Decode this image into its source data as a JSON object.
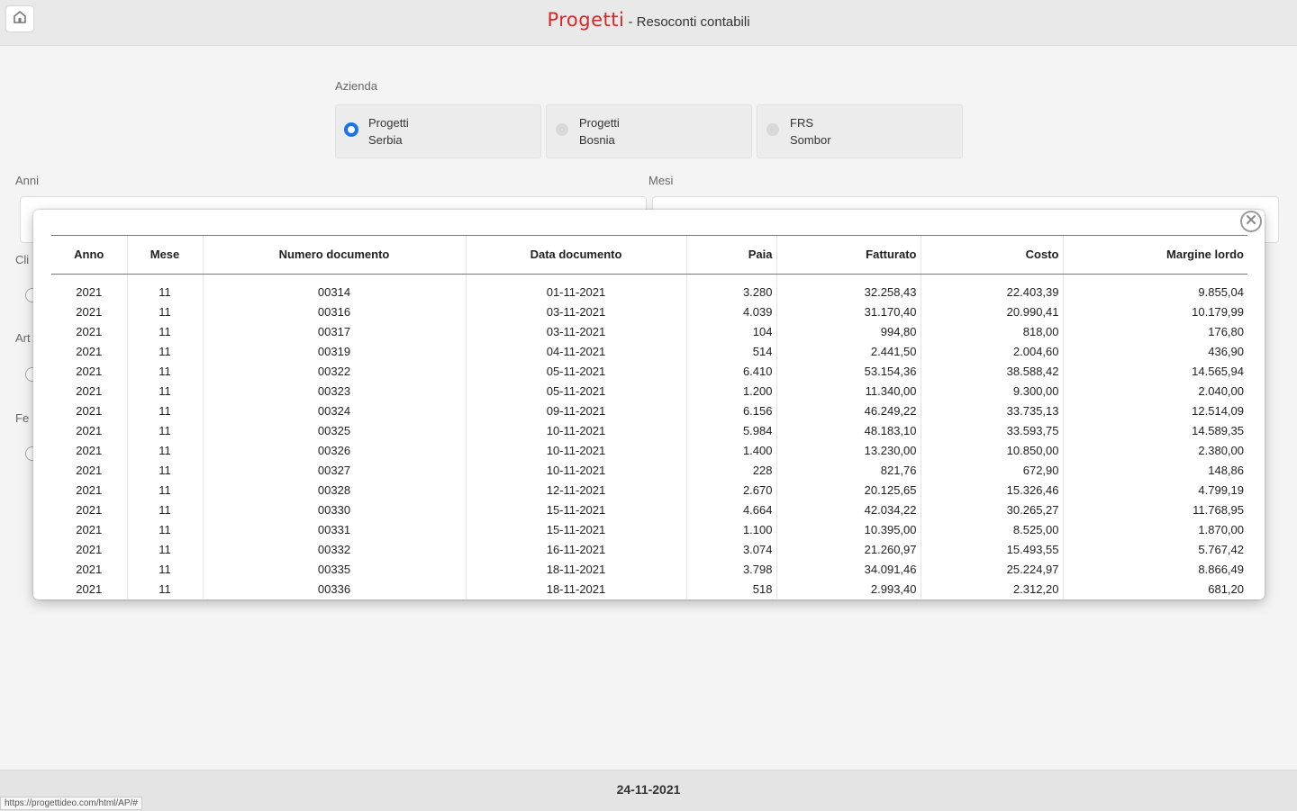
{
  "header": {
    "brand": "Progetti",
    "separator": " - ",
    "subtitle": "Resoconti contabili"
  },
  "azienda": {
    "label": "Azienda",
    "options": [
      {
        "line1": "Progetti",
        "line2": "Serbia",
        "selected": true
      },
      {
        "line1": "Progetti",
        "line2": "Bosnia",
        "selected": false
      },
      {
        "line1": "FRS",
        "line2": "Sombor",
        "selected": false
      }
    ]
  },
  "filters": {
    "anni_label": "Anni",
    "mesi_label": "Mesi",
    "cli_label": "Cli",
    "art_label": "Art",
    "fe_label": "Fe"
  },
  "table": {
    "columns": [
      "Anno",
      "Mese",
      "Numero documento",
      "Data documento",
      "Paia",
      "Fatturato",
      "Costo",
      "Margine lordo"
    ],
    "rows": [
      [
        "2021",
        "11",
        "00314",
        "01-11-2021",
        "3.280",
        "32.258,43",
        "22.403,39",
        "9.855,04"
      ],
      [
        "2021",
        "11",
        "00316",
        "03-11-2021",
        "4.039",
        "31.170,40",
        "20.990,41",
        "10.179,99"
      ],
      [
        "2021",
        "11",
        "00317",
        "03-11-2021",
        "104",
        "994,80",
        "818,00",
        "176,80"
      ],
      [
        "2021",
        "11",
        "00319",
        "04-11-2021",
        "514",
        "2.441,50",
        "2.004,60",
        "436,90"
      ],
      [
        "2021",
        "11",
        "00322",
        "05-11-2021",
        "6.410",
        "53.154,36",
        "38.588,42",
        "14.565,94"
      ],
      [
        "2021",
        "11",
        "00323",
        "05-11-2021",
        "1.200",
        "11.340,00",
        "9.300,00",
        "2.040,00"
      ],
      [
        "2021",
        "11",
        "00324",
        "09-11-2021",
        "6.156",
        "46.249,22",
        "33.735,13",
        "12.514,09"
      ],
      [
        "2021",
        "11",
        "00325",
        "10-11-2021",
        "5.984",
        "48.183,10",
        "33.593,75",
        "14.589,35"
      ],
      [
        "2021",
        "11",
        "00326",
        "10-11-2021",
        "1.400",
        "13.230,00",
        "10.850,00",
        "2.380,00"
      ],
      [
        "2021",
        "11",
        "00327",
        "10-11-2021",
        "228",
        "821,76",
        "672,90",
        "148,86"
      ],
      [
        "2021",
        "11",
        "00328",
        "12-11-2021",
        "2.670",
        "20.125,65",
        "15.326,46",
        "4.799,19"
      ],
      [
        "2021",
        "11",
        "00330",
        "15-11-2021",
        "4.664",
        "42.034,22",
        "30.265,27",
        "11.768,95"
      ],
      [
        "2021",
        "11",
        "00331",
        "15-11-2021",
        "1.100",
        "10.395,00",
        "8.525,00",
        "1.870,00"
      ],
      [
        "2021",
        "11",
        "00332",
        "16-11-2021",
        "3.074",
        "21.260,97",
        "15.493,55",
        "5.767,42"
      ],
      [
        "2021",
        "11",
        "00335",
        "18-11-2021",
        "3.798",
        "34.091,46",
        "25.224,97",
        "8.866,49"
      ],
      [
        "2021",
        "11",
        "00336",
        "18-11-2021",
        "518",
        "2.993,40",
        "2.312,20",
        "681,20"
      ]
    ]
  },
  "footer": {
    "date": "24-11-2021",
    "status_url": "https://progettideo.com/html/AP/#"
  },
  "colors": {
    "brand": "#d62828",
    "accent": "#1a73e8"
  },
  "icons": {
    "home": "home-icon",
    "close": "close-icon"
  }
}
